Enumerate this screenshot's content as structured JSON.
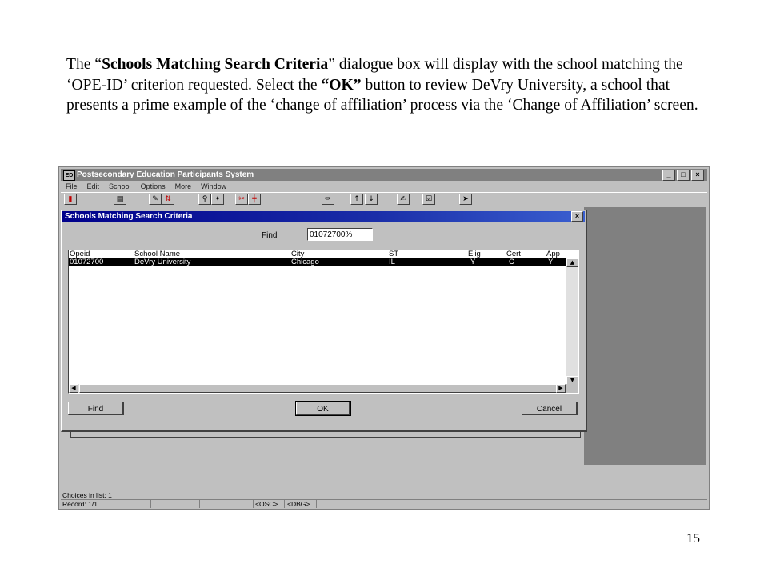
{
  "instructions": {
    "t1": "The “",
    "b1": "Schools Matching Search Criteria",
    "t2": "” dialogue box will display with the school matching the ‘OPE-ID’  criterion requested.  Select the ",
    "b2": "“OK”",
    "t3": " button to review DeVry University, a school that presents a prime example of the ‘change of affiliation’ process via the ‘Change of Affiliation’ screen."
  },
  "page_number": "15",
  "window": {
    "title": "Postsecondary Education Participants System",
    "app_icon": "ED",
    "caption_buttons": [
      "_",
      "□",
      "×"
    ]
  },
  "menu": [
    "File",
    "Edit",
    "School",
    "Options",
    "More",
    "Window"
  ],
  "toolbar_icons": [
    "exit-icon",
    "print-icon",
    "edit-icon",
    "sort-icon",
    "search-icon",
    "query-icon",
    "clear-icon",
    "insert-icon",
    "pencil-icon",
    "up-arrow-icon",
    "down-arrow-icon",
    "write-icon",
    "check-icon",
    "help-icon"
  ],
  "dialog": {
    "title": "Schools Matching Search Criteria",
    "close": "×",
    "find_label": "Find",
    "find_value": "01072700%",
    "columns": [
      "Opeid",
      "School Name",
      "City",
      "ST",
      "Elig",
      "Cert",
      "App"
    ],
    "rows": [
      {
        "opeid": "01072700",
        "name": "DeVry University",
        "city": "Chicago",
        "st": "IL",
        "elig": "Y",
        "cert": "C",
        "app": "Y"
      }
    ],
    "buttons": {
      "find": "Find",
      "ok": "OK",
      "cancel": "Cancel"
    }
  },
  "status": {
    "choices": "Choices in list: 1",
    "record": "Record: 1/1",
    "osc": "<OSC>",
    "dbg": "<DBG>"
  }
}
